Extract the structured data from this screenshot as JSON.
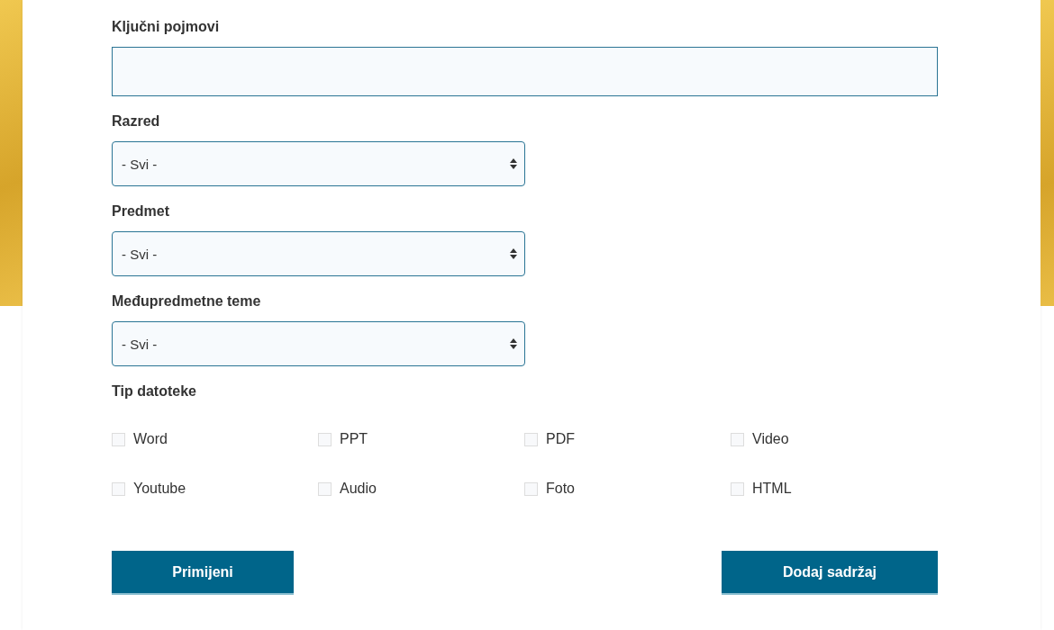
{
  "keywords": {
    "label": "Ključni pojmovi"
  },
  "selects": [
    {
      "label": "Razred",
      "value": "- Svi -"
    },
    {
      "label": "Predmet",
      "value": "- Svi -"
    },
    {
      "label": "Međupredmetne teme",
      "value": "- Svi -"
    }
  ],
  "file_type": {
    "label": "Tip datoteke",
    "options": [
      {
        "label": "Word",
        "checked": false
      },
      {
        "label": "PPT",
        "checked": false
      },
      {
        "label": "PDF",
        "checked": false
      },
      {
        "label": "Video",
        "checked": false
      },
      {
        "label": "Youtube",
        "checked": false
      },
      {
        "label": "Audio",
        "checked": false
      },
      {
        "label": "Foto",
        "checked": false
      },
      {
        "label": "HTML",
        "checked": false
      }
    ]
  },
  "buttons": [
    "Primijeni",
    "Dodaj sadržaj"
  ]
}
